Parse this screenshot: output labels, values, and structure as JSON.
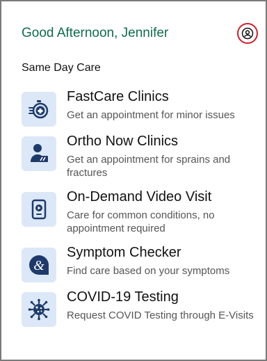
{
  "header": {
    "greeting": "Good Afternoon, Jennifer"
  },
  "section": {
    "title": "Same Day Care"
  },
  "items": [
    {
      "title": "FastCare Clinics",
      "desc": "Get an appointment for minor issues",
      "icon": "stopwatch-medical-icon"
    },
    {
      "title": "Ortho Now Clinics",
      "desc": "Get an appointment for sprains and fractures",
      "icon": "person-cast-icon"
    },
    {
      "title": "On-Demand Video Visit",
      "desc": "Care for common conditions, no appointment required",
      "icon": "tablet-video-icon"
    },
    {
      "title": "Symptom Checker",
      "desc": "Find care based on your symptoms",
      "icon": "ampersand-badge-icon"
    },
    {
      "title": "COVID-19 Testing",
      "desc": "Request COVID Testing through E-Visits",
      "icon": "virus-icon"
    }
  ],
  "colors": {
    "accent": "#0f6b4d",
    "iconTile": "#dce8f8",
    "iconNavy": "#1e3a6b",
    "profileRing": "#d11f2a"
  }
}
